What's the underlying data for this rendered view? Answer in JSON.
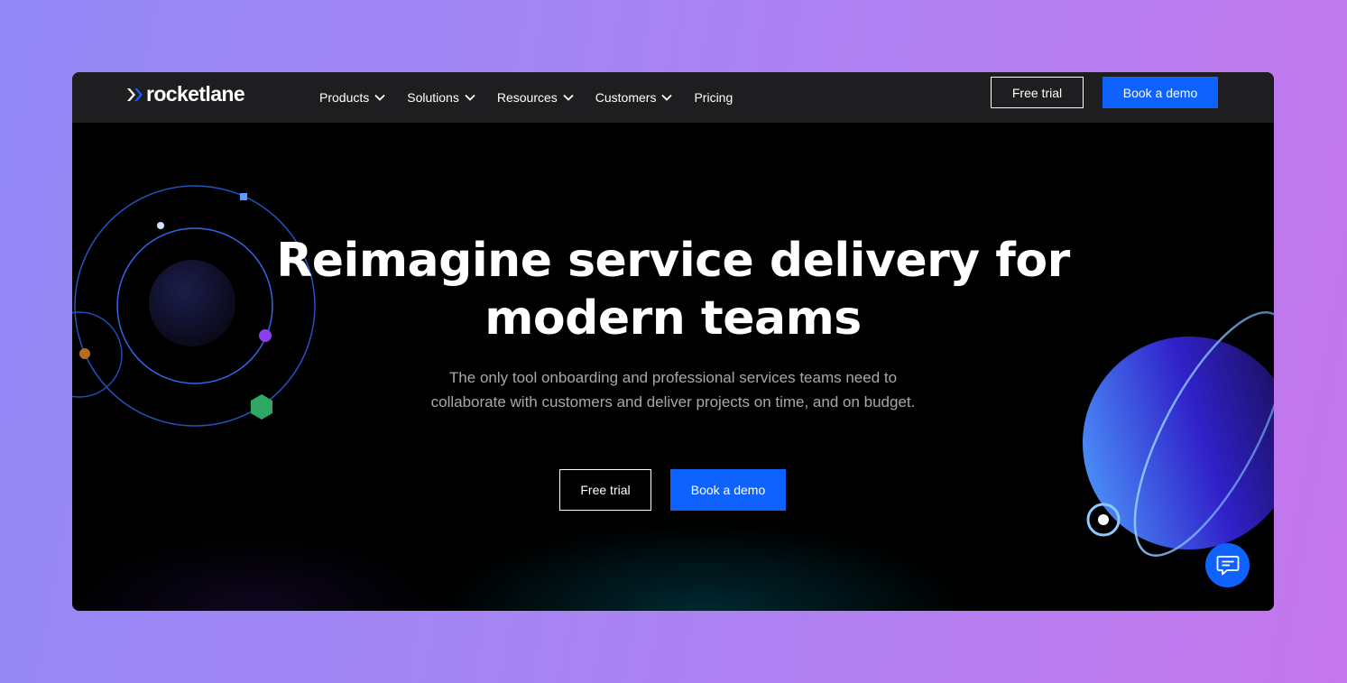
{
  "brand": {
    "name": "rocketlane"
  },
  "nav": {
    "items": [
      {
        "label": "Products",
        "has_dropdown": true
      },
      {
        "label": "Solutions",
        "has_dropdown": true
      },
      {
        "label": "Resources",
        "has_dropdown": true
      },
      {
        "label": "Customers",
        "has_dropdown": true
      },
      {
        "label": "Pricing",
        "has_dropdown": false
      }
    ],
    "free_trial_label": "Free trial",
    "book_demo_label": "Book a demo"
  },
  "hero": {
    "headline_line1": "Reimagine service delivery for",
    "headline_line2": "modern teams",
    "subtitle": "The only tool onboarding and professional services teams need to collaborate with customers and deliver projects on time, and on budget.",
    "free_trial_label": "Free trial",
    "book_demo_label": "Book a demo"
  },
  "icons": {
    "logo": "rocketlane-chevron-logo-icon",
    "dropdown": "chevron-down-icon",
    "chat": "chat-bubble-icon"
  },
  "colors": {
    "primary": "#0f62fe",
    "nav_bg": "#1e1e20",
    "hero_bg": "#000000",
    "page_gradient_start": "#9489f7",
    "page_gradient_end": "#c577ec"
  }
}
